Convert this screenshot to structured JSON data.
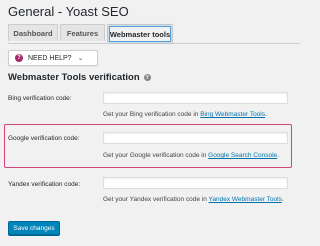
{
  "page": {
    "title": "General - Yoast SEO"
  },
  "tabs": [
    {
      "label": "Dashboard"
    },
    {
      "label": "Features"
    },
    {
      "label": "Webmaster tools"
    }
  ],
  "help_button": {
    "label": "NEED HELP?",
    "icon": "question-circle-icon",
    "chevron": "chevron-down-icon",
    "icon_color": "#a4286a"
  },
  "section": {
    "title": "Webmaster Tools verification",
    "info_icon": "help-circle-icon"
  },
  "fields": [
    {
      "label": "Bing verification code:",
      "value": "",
      "desc_prefix": "Get your Bing verification code in ",
      "link": "Bing Webmaster Tools",
      "desc_suffix": "."
    },
    {
      "label": "Google verification code:",
      "value": "",
      "desc_prefix": "Get your Google verification code in ",
      "link": "Google Search Console",
      "desc_suffix": "."
    },
    {
      "label": "Yandex verification code:",
      "value": "",
      "desc_prefix": "Get your Yandex verification code in ",
      "link": "Yandex Webmaster Tools",
      "desc_suffix": "."
    }
  ],
  "save_button": {
    "label": "Save changes",
    "color": "#0085ba"
  },
  "highlight_color": "#d2417b"
}
